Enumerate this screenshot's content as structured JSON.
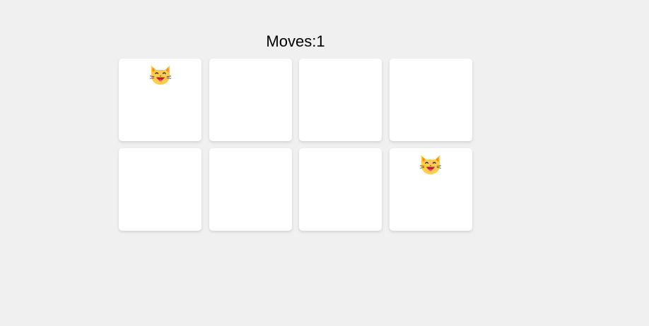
{
  "game": {
    "moves_label": "Moves:",
    "moves_count": "1"
  },
  "board": {
    "cards": [
      {
        "face_up": true,
        "icon": "cat-face-icon"
      },
      {
        "face_up": false,
        "icon": ""
      },
      {
        "face_up": false,
        "icon": ""
      },
      {
        "face_up": false,
        "icon": ""
      },
      {
        "face_up": false,
        "icon": ""
      },
      {
        "face_up": false,
        "icon": ""
      },
      {
        "face_up": false,
        "icon": ""
      },
      {
        "face_up": true,
        "icon": "cat-face-icon"
      }
    ]
  },
  "colors": {
    "background": "#f0f0f0",
    "card": "#ffffff",
    "cat_fur": "#FFCC4D",
    "cat_dark": "#F4900C",
    "mouth": "#BB1A34",
    "tongue": "#E75A70"
  }
}
